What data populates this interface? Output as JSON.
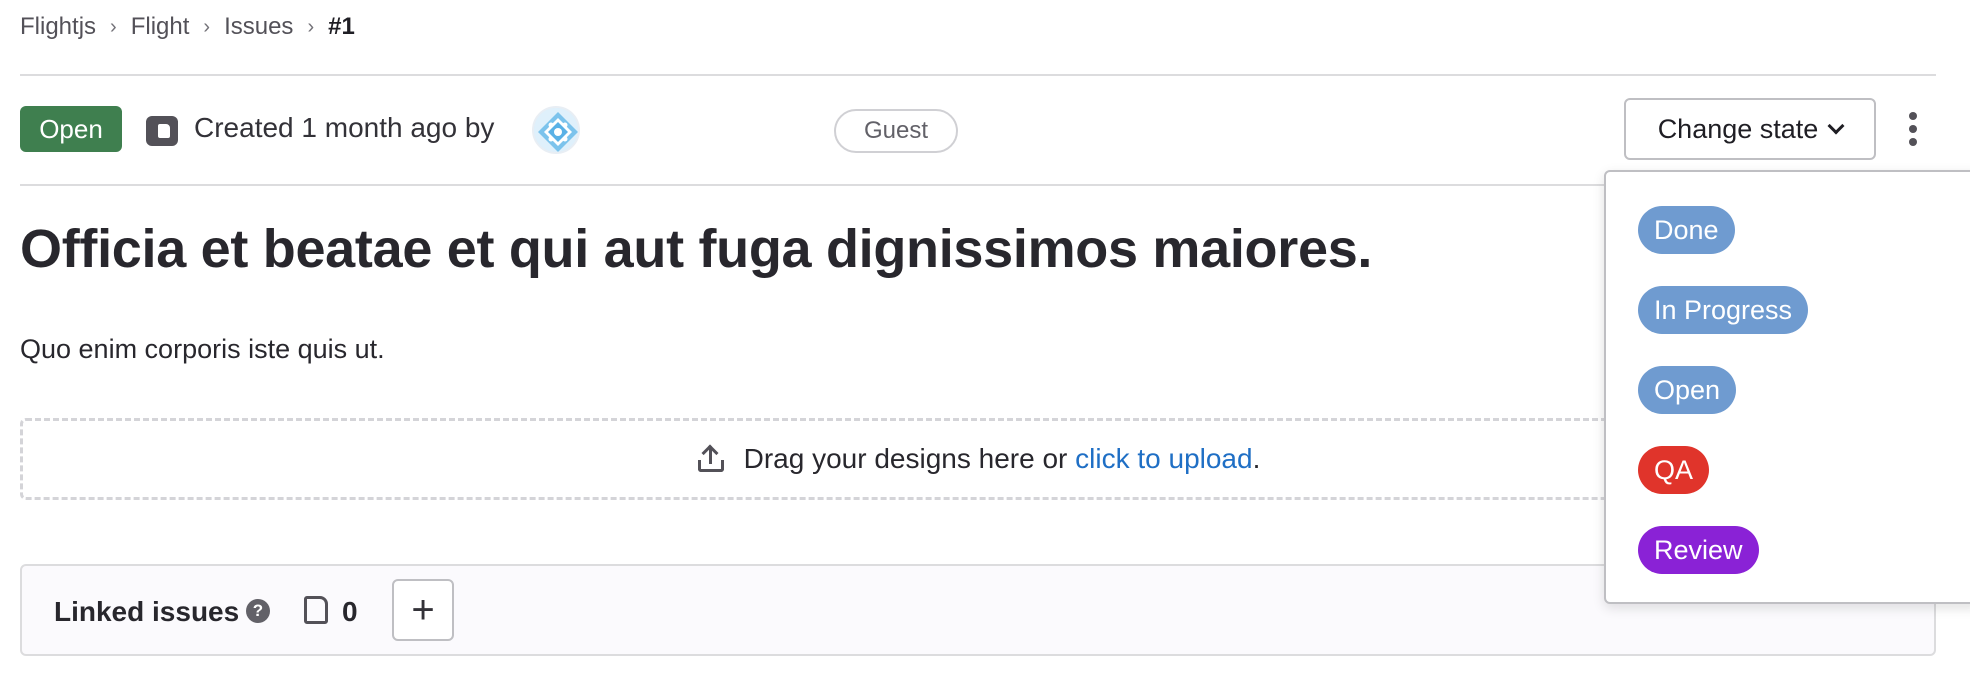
{
  "breadcrumb": {
    "items": [
      "Flightjs",
      "Flight",
      "Issues"
    ],
    "current": "#1",
    "separator": "›"
  },
  "issue": {
    "status": "Open",
    "status_color": "#3f7f4f",
    "created_text": "Created 1 month ago by",
    "author_role": "Guest",
    "title": "Officia et beatae et qui aut fuga dignissimos maiores.",
    "description": "Quo enim corporis iste quis ut."
  },
  "actions": {
    "change_state_label": "Change state",
    "more_icon": "vertical-ellipsis-icon"
  },
  "upload": {
    "prefix": "Drag your designs here or ",
    "link": "click to upload",
    "suffix": "."
  },
  "linked_issues": {
    "label": "Linked issues",
    "count": "0",
    "add_label": "+"
  },
  "state_dropdown": {
    "options": [
      {
        "label": "Done",
        "color": "#6f9bd0"
      },
      {
        "label": "In Progress",
        "color": "#6f9bd0"
      },
      {
        "label": "Open",
        "color": "#6f9bd0"
      },
      {
        "label": "QA",
        "color": "#e0342b"
      },
      {
        "label": "Review",
        "color": "#8a22d6"
      }
    ]
  }
}
